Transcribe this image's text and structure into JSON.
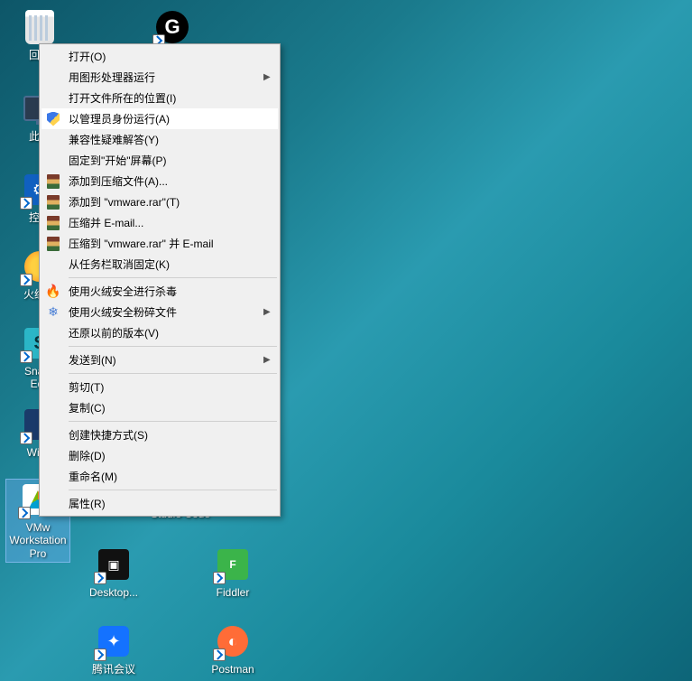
{
  "desktop": {
    "icons": {
      "recycle_bin": "回收",
      "logitech": "",
      "this_pc": "此电",
      "control_panel": "控制",
      "huorong": "火绒安",
      "snagit": "Snagit\nEdit",
      "winscp": "WinS",
      "vmware": "VMw\nWorkstation\nPro",
      "vscode": "Studio Code",
      "desktop_app": "Desktop...",
      "fiddler": "Fiddler",
      "tencent_meeting": "腾讯会议",
      "postman": "Postman"
    }
  },
  "context_menu": {
    "open": "打开(O)",
    "run_with_gpu": "用图形处理器运行",
    "open_file_location": "打开文件所在的位置(I)",
    "run_as_admin": "以管理员身份运行(A)",
    "compat_troubleshoot": "兼容性疑难解答(Y)",
    "pin_to_start": "固定到\"开始\"屏幕(P)",
    "add_to_archive": "添加到压缩文件(A)...",
    "add_to_vmware_rar": "添加到 \"vmware.rar\"(T)",
    "compress_email": "压缩并 E-mail...",
    "compress_vmware_email": "压缩到 \"vmware.rar\" 并 E-mail",
    "unpin_taskbar": "从任务栏取消固定(K)",
    "huorong_scan": "使用火绒安全进行杀毒",
    "huorong_shred": "使用火绒安全粉碎文件",
    "restore_previous": "还原以前的版本(V)",
    "send_to": "发送到(N)",
    "cut": "剪切(T)",
    "copy": "复制(C)",
    "create_shortcut": "创建快捷方式(S)",
    "delete": "删除(D)",
    "rename": "重命名(M)",
    "properties": "属性(R)"
  }
}
